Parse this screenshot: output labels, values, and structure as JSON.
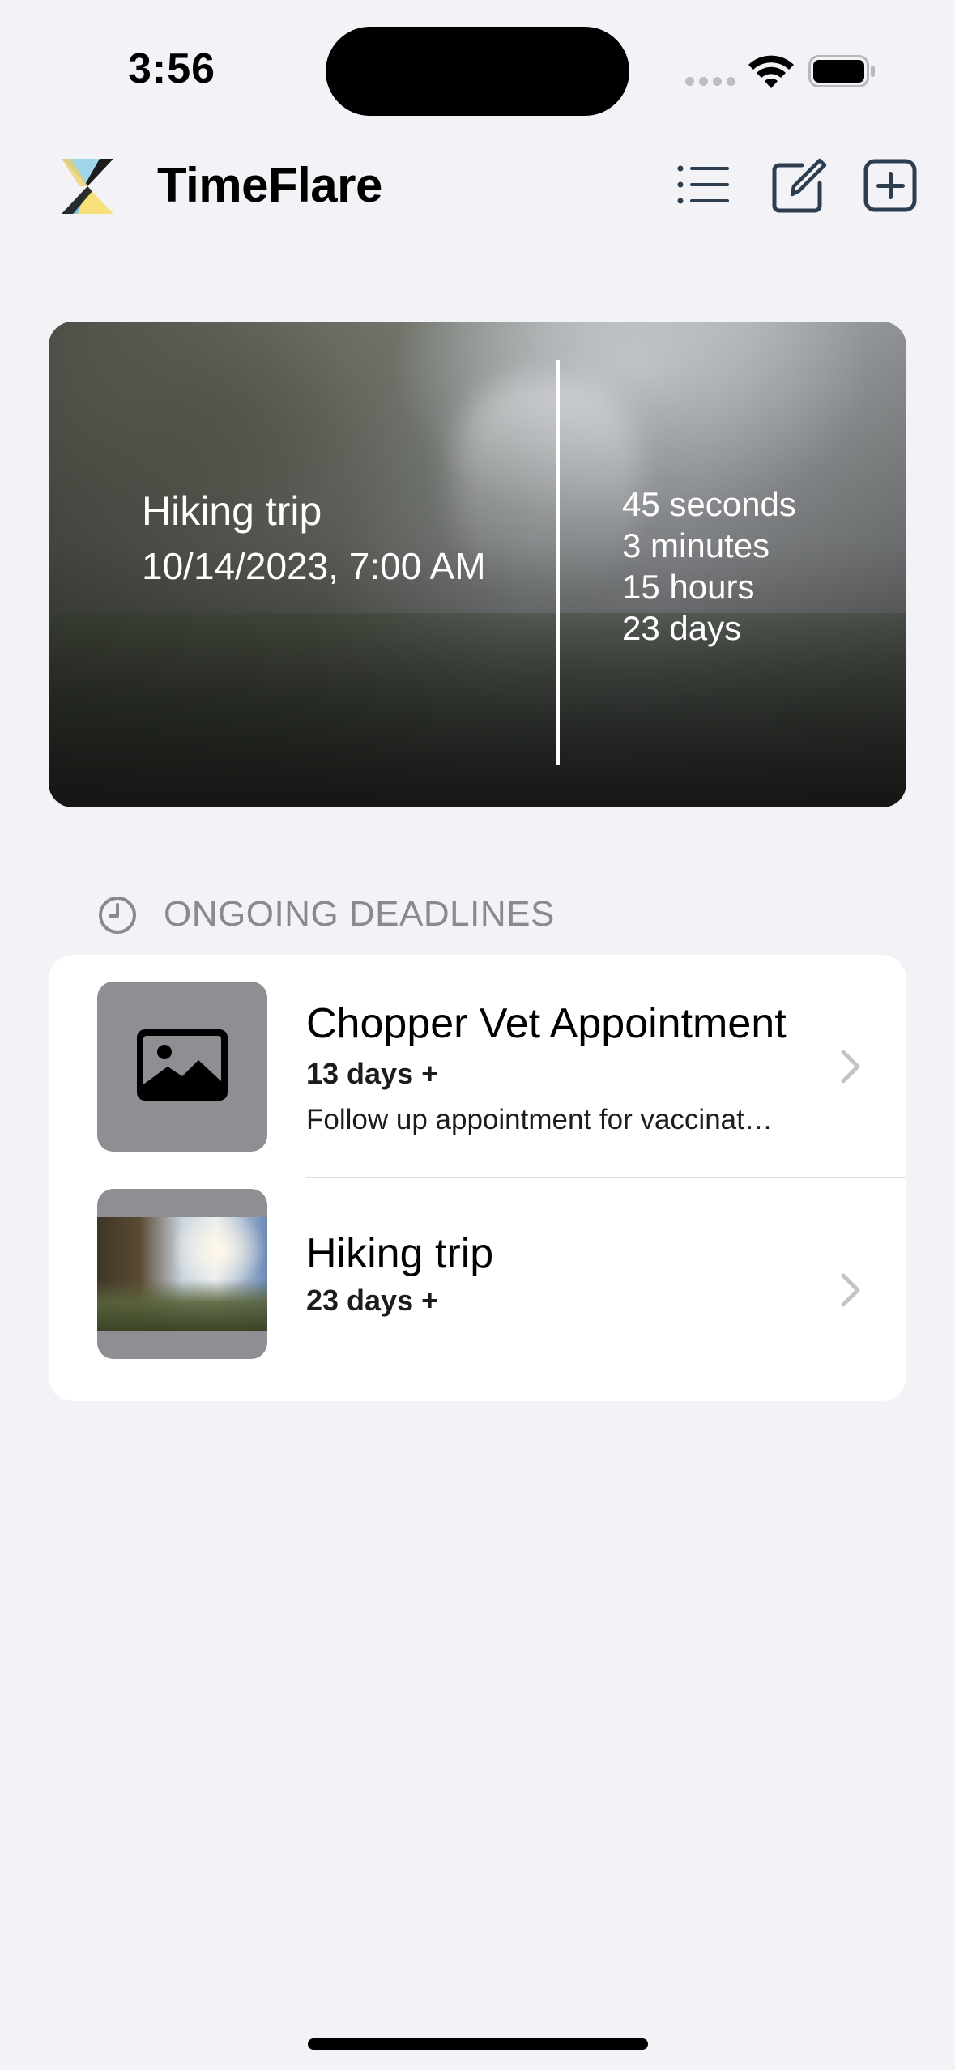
{
  "status_bar": {
    "time": "3:56"
  },
  "header": {
    "app_title": "TimeFlare"
  },
  "featured": {
    "title": "Hiking trip",
    "date": "10/14/2023, 7:00 AM",
    "countdown": [
      "45 seconds",
      "3 minutes",
      "15 hours",
      "23 days"
    ]
  },
  "section": {
    "title": "ONGOING DEADLINES"
  },
  "deadlines": [
    {
      "title": "Chopper Vet Appointment",
      "remaining": "13 days +",
      "description": "Follow up appointment for vaccinat…",
      "thumbnail": "image-placeholder-icon"
    },
    {
      "title": "Hiking trip",
      "remaining": "23 days +",
      "thumbnail": "waterfall-photo"
    }
  ],
  "colors": {
    "background": "#f2f2f7",
    "section_title": "#8a8a8e",
    "thumbnail_gray": "#8e8e93",
    "separator": "#dcdce0"
  }
}
